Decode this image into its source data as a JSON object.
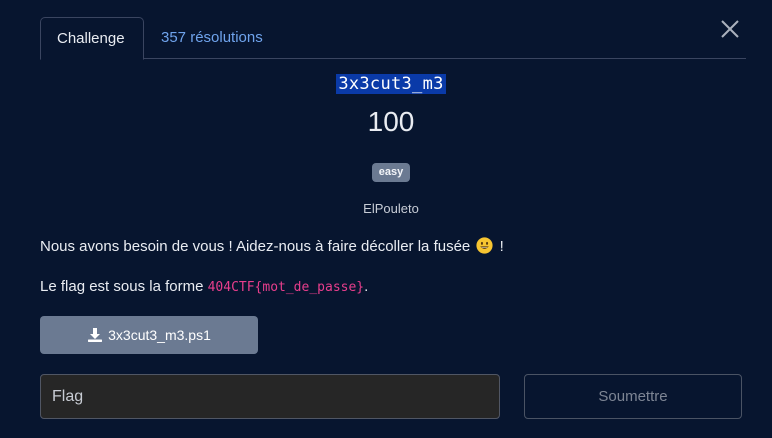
{
  "tabs": [
    {
      "label": "Challenge"
    },
    {
      "label": "357 résolutions"
    }
  ],
  "challenge": {
    "name": "3x3cut3_m3",
    "points": "100",
    "difficulty": "easy",
    "author": "ElPouleto"
  },
  "description": {
    "line1_text": "Nous avons besoin de vous ! Aidez-nous à faire décoller la fusée",
    "line1_suffix": " !",
    "line2_prefix": "Le flag est sous la forme ",
    "line2_code": "404CTF{mot_de_passe}",
    "line2_suffix": "."
  },
  "download": {
    "label": "3x3cut3_m3.ps1",
    "icon": "download-icon"
  },
  "form": {
    "flag_placeholder": "Flag",
    "flag_value": "",
    "submit_label": "Soumettre"
  },
  "colors": {
    "background": "#07152f",
    "link": "#6fa3ec",
    "badge": "#6b7a92",
    "code": "#e83e8c",
    "highlight": "#0a3aa8"
  }
}
